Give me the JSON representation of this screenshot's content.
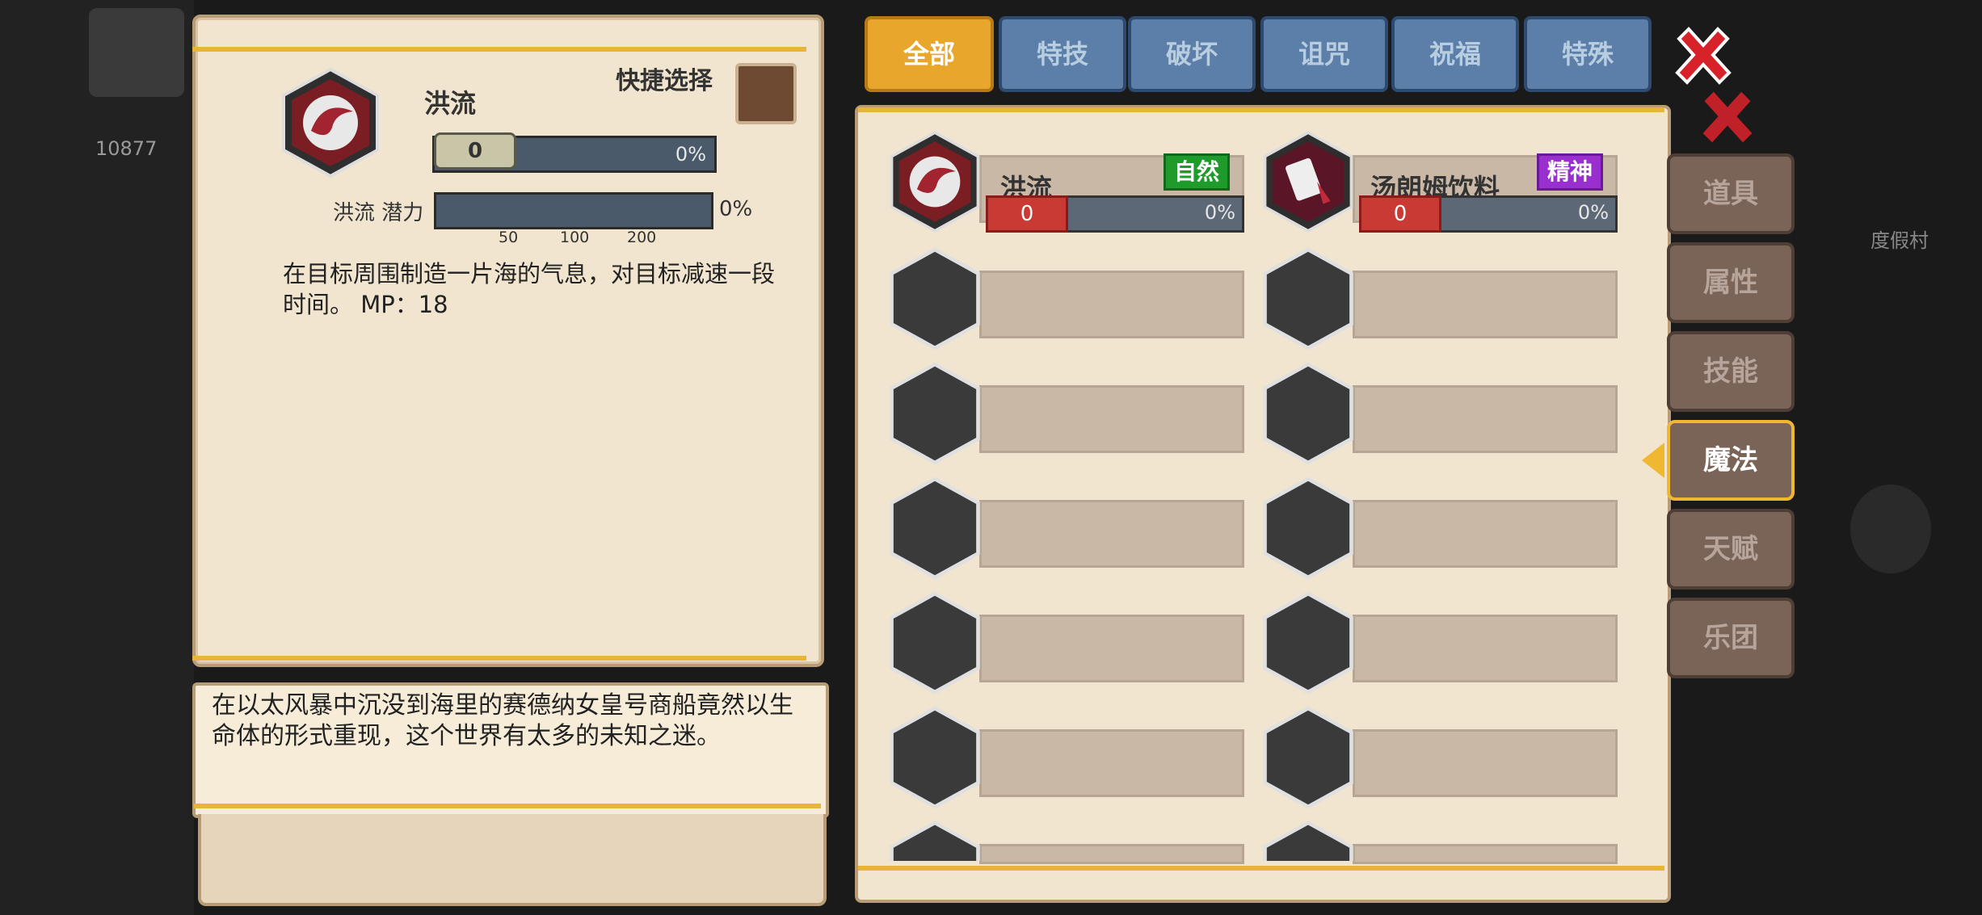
{
  "detail": {
    "skill_name": "洪流",
    "quick_select_label": "快捷选择",
    "level_value": "0",
    "level_pct": "0%",
    "potential_label": "洪流 潜力",
    "potential_pct": "0%",
    "ticks": [
      "50",
      "100",
      "200"
    ],
    "description": "在目标周围制造一片海的气息，对目标减速一段时间。 MP：18",
    "lore": "在以太风暴中沉没到海里的赛德纳女皇号商船竟然以生命体的形式重现，这个世界有太多的未知之迷。"
  },
  "tabs": [
    "全部",
    "特技",
    "破坏",
    "诅咒",
    "祝福",
    "特殊"
  ],
  "side_tabs": [
    "道具",
    "属性",
    "技能",
    "魔法",
    "天赋",
    "乐团"
  ],
  "skills": [
    {
      "name": "洪流",
      "tag": "自然",
      "level": "0",
      "pct": "0%"
    },
    {
      "name": "汤朗姆饮料",
      "tag": "精神",
      "level": "0",
      "pct": "0%"
    }
  ],
  "hud": {
    "coins": "10877",
    "resort_label": "度假村"
  },
  "colors": {
    "accent_gold": "#e8a62c",
    "tag_nature": "#1f9b2c",
    "tag_spirit": "#9a2fd0",
    "close_red": "#d8222a"
  },
  "icons": [
    "flood-skill-icon",
    "rum-drink-skill-icon",
    "close-icon"
  ]
}
